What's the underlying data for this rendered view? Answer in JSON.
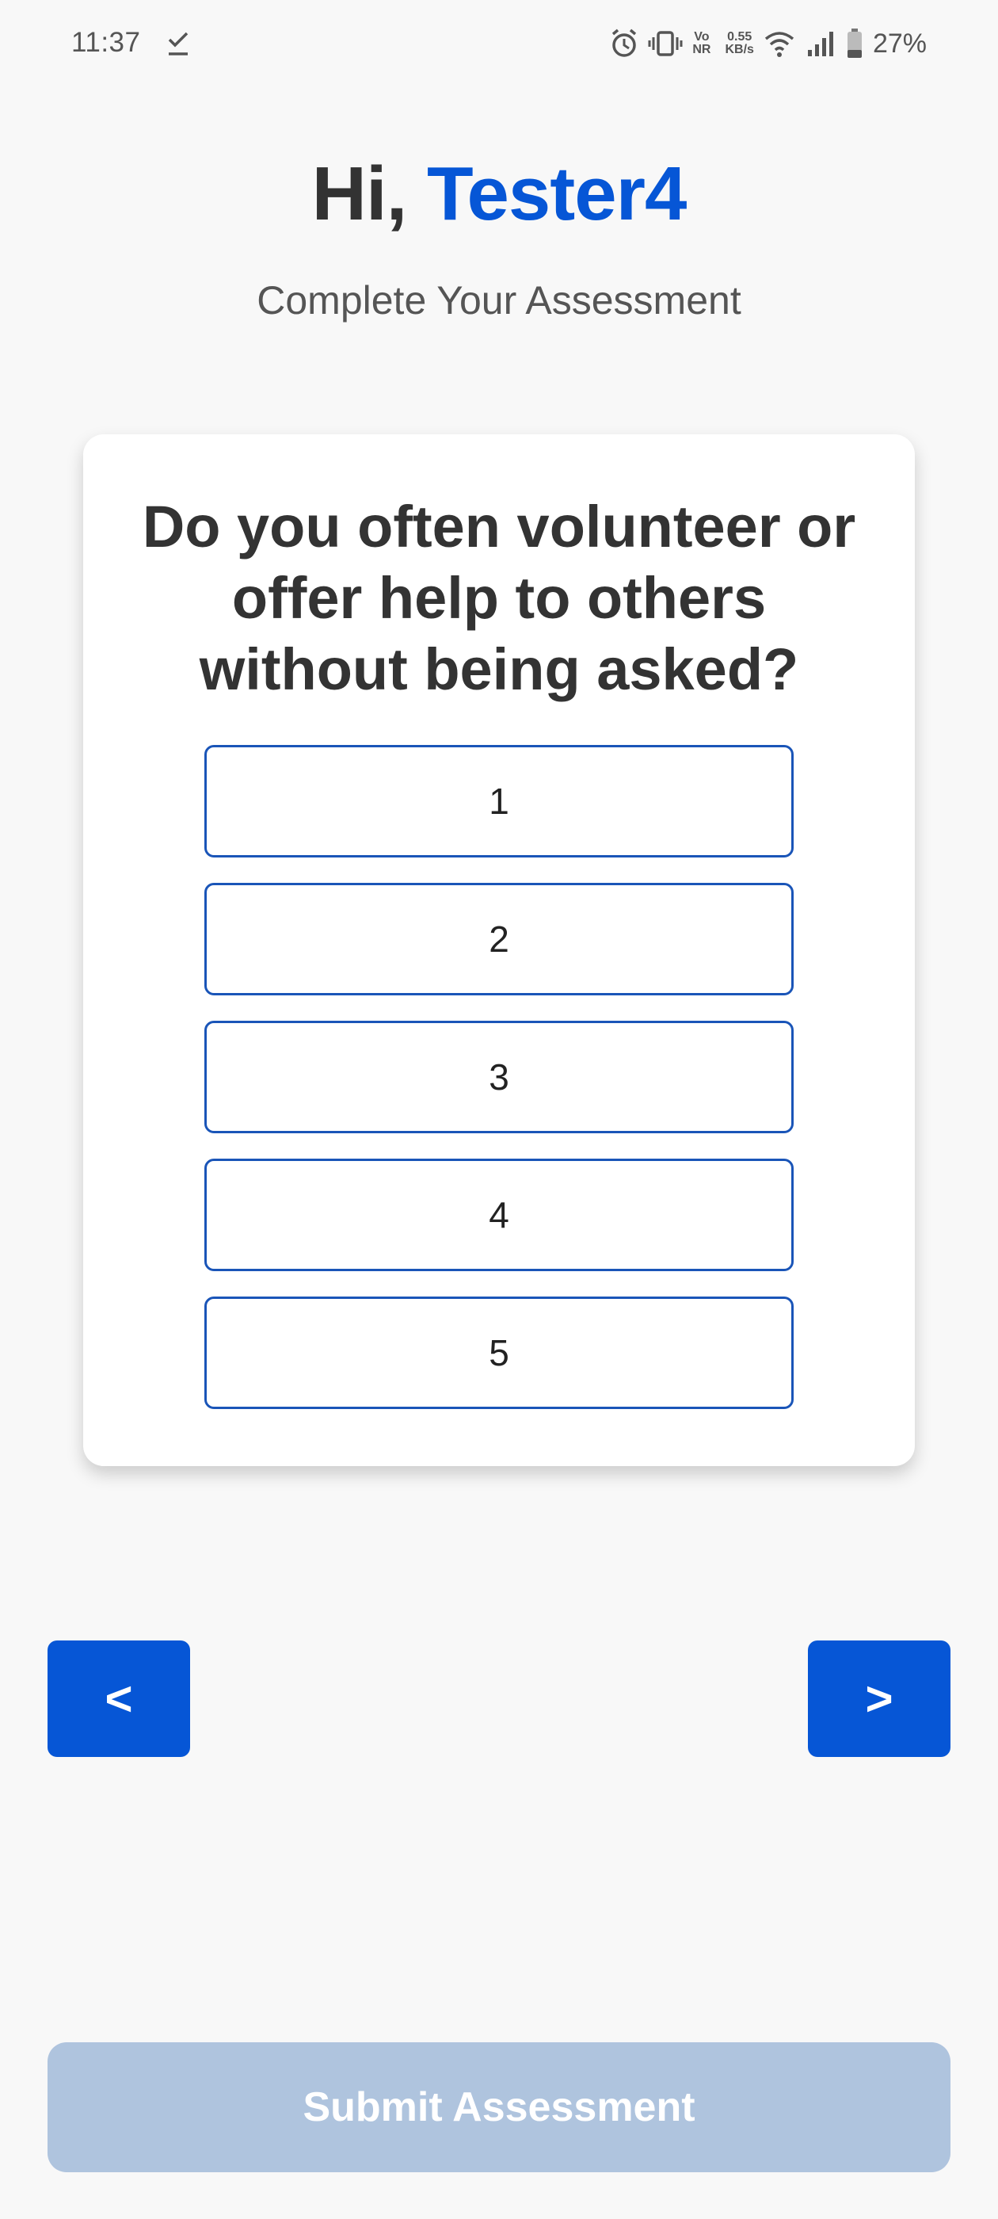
{
  "status_bar": {
    "time": "11:37",
    "vo_top": "Vo",
    "vo_bottom": "NR",
    "speed_top": "0.55",
    "speed_bottom": "KB/s",
    "battery_percent": "27%"
  },
  "header": {
    "greeting_prefix": "Hi, ",
    "user_name": "Tester4",
    "subtitle": "Complete Your Assessment"
  },
  "question": {
    "text": "Do you often volunteer or offer help to others without being asked?",
    "options": [
      "1",
      "2",
      "3",
      "4",
      "5"
    ]
  },
  "navigation": {
    "prev_label": "<",
    "next_label": ">"
  },
  "submit": {
    "label": "Submit Assessment"
  },
  "colors": {
    "accent": "#0656d6",
    "submit_disabled": "#afc4de",
    "option_border": "#1a55b8",
    "background": "#f8f8f8"
  }
}
